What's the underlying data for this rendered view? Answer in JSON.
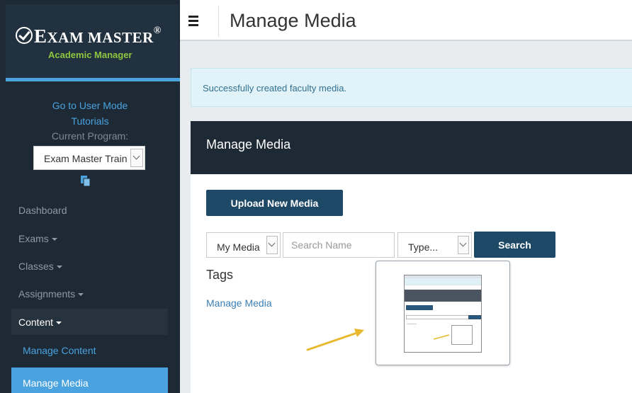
{
  "brand": {
    "title_part1": "E",
    "title_part2": "XAM MASTER",
    "registered": "®",
    "subtitle": "Academic Manager",
    "accent_color": "#8dc63f"
  },
  "sidebar": {
    "user_mode_link": "Go to User Mode",
    "tutorials_link": "Tutorials",
    "current_program_label": "Current Program:",
    "program_select_value": "Exam Master Train",
    "program_select_icon": "chevron-down-icon",
    "copy_icon": "document-icon",
    "nav": [
      {
        "label": "Dashboard",
        "has_caret": false
      },
      {
        "label": "Exams",
        "has_caret": true
      },
      {
        "label": "Classes",
        "has_caret": true
      },
      {
        "label": "Assignments",
        "has_caret": true
      },
      {
        "label": "Content",
        "has_caret": true
      }
    ],
    "sub_nav": [
      {
        "label": "Manage Content"
      },
      {
        "label": "Manage Media"
      }
    ],
    "colors": {
      "bg": "#1d2935",
      "active": "#4aa3df"
    }
  },
  "header": {
    "menu_icon": "hamburger-icon",
    "title": "Manage Media"
  },
  "alert": {
    "message": "Successfully created faculty media."
  },
  "panel": {
    "title": "Manage Media",
    "upload_button": "Upload New Media",
    "media_filter_value": "My Media",
    "search_placeholder": "Search Name",
    "type_filter_value": "Type...",
    "search_button": "Search",
    "tags_heading": "Tags",
    "tag_link": "Manage Media",
    "button_color": "#1d4866"
  },
  "overlay": {
    "thumbnail_icon": "screenshot-thumbnail",
    "arrow_icon": "annotation-arrow-icon",
    "arrow_color": "#e8b92e"
  }
}
